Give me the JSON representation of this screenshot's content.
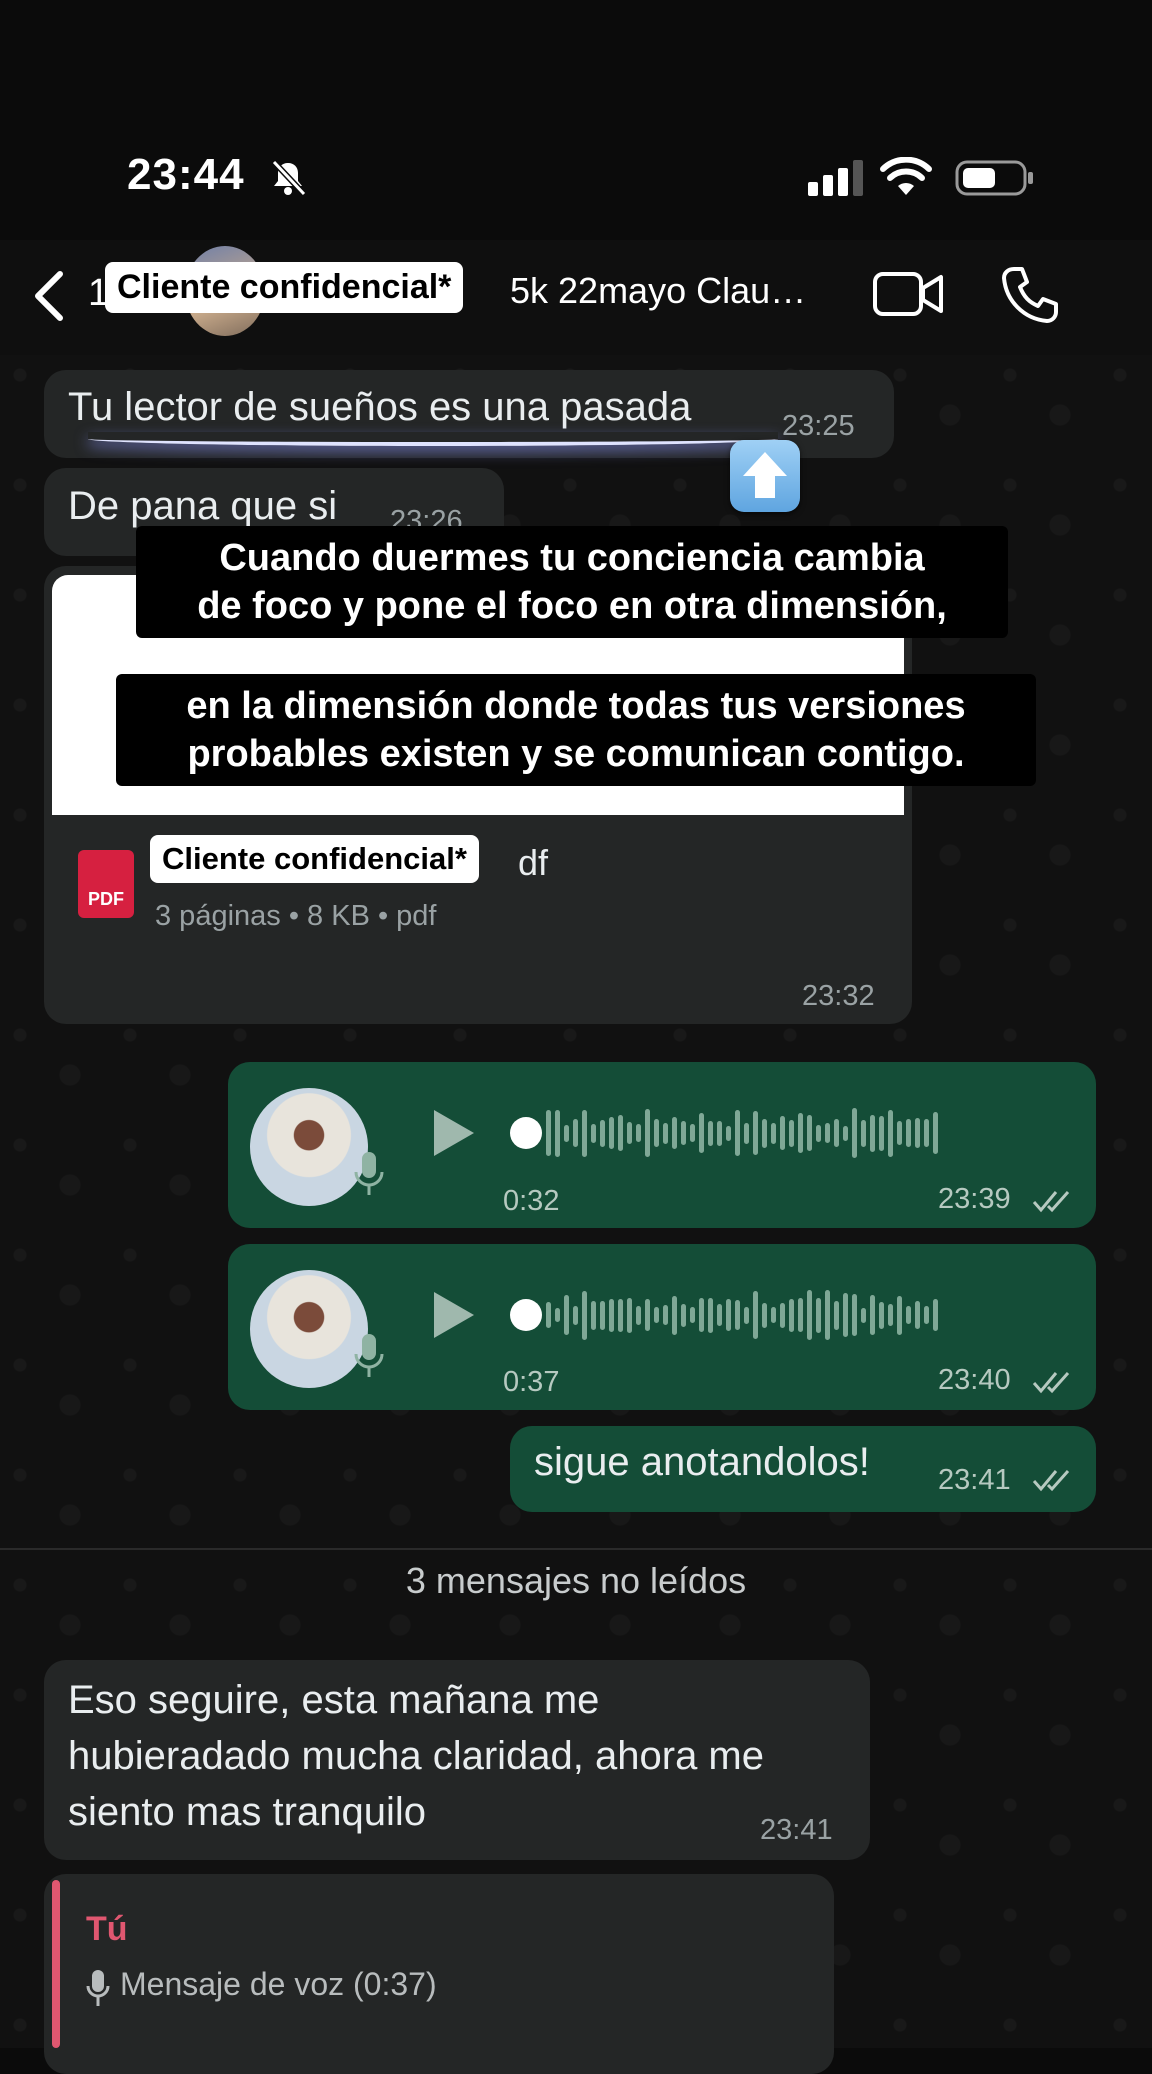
{
  "status_bar": {
    "time": "23:44"
  },
  "header": {
    "partial_digit": "1",
    "title": "5k 22mayo Clau…",
    "redaction_label": "Cliente confidencial*"
  },
  "messages": {
    "m1": {
      "text": "Tu lector de sueños es una pasada",
      "time": "23:25"
    },
    "m2": {
      "text": "De pana que si",
      "time": "23:26"
    },
    "doc": {
      "redaction_label": "Cliente confidencial*",
      "name_tail": "df",
      "meta": "3 páginas • 8 KB • pdf",
      "pdf_badge": "PDF",
      "time": "23:32"
    },
    "voice1": {
      "duration": "0:32",
      "time": "23:39"
    },
    "voice2": {
      "duration": "0:37",
      "time": "23:40"
    },
    "m3": {
      "text": "sigue anotandolos!",
      "time": "23:41"
    },
    "m4": {
      "line1": "Eso seguire, esta mañana me",
      "line2": "hubieradado mucha claridad, ahora me",
      "line3": "siento mas tranquilo",
      "time": "23:41"
    },
    "reply": {
      "author": "Tú",
      "text": "Mensaje de voz (0:37)"
    }
  },
  "captions": {
    "c1_line1": "Cuando duermes tu conciencia cambia",
    "c1_line2": "de foco y pone el foco en otra dimensión,",
    "c2_line1": "en la dimensión donde todas tus versiones",
    "c2_line2": "probables existen y se comunican contigo."
  },
  "unread_divider": "3 mensajes no leídos",
  "colors": {
    "incoming_bubble": "#242626",
    "outgoing_bubble": "#144d37",
    "reply_accent": "#e05770"
  }
}
